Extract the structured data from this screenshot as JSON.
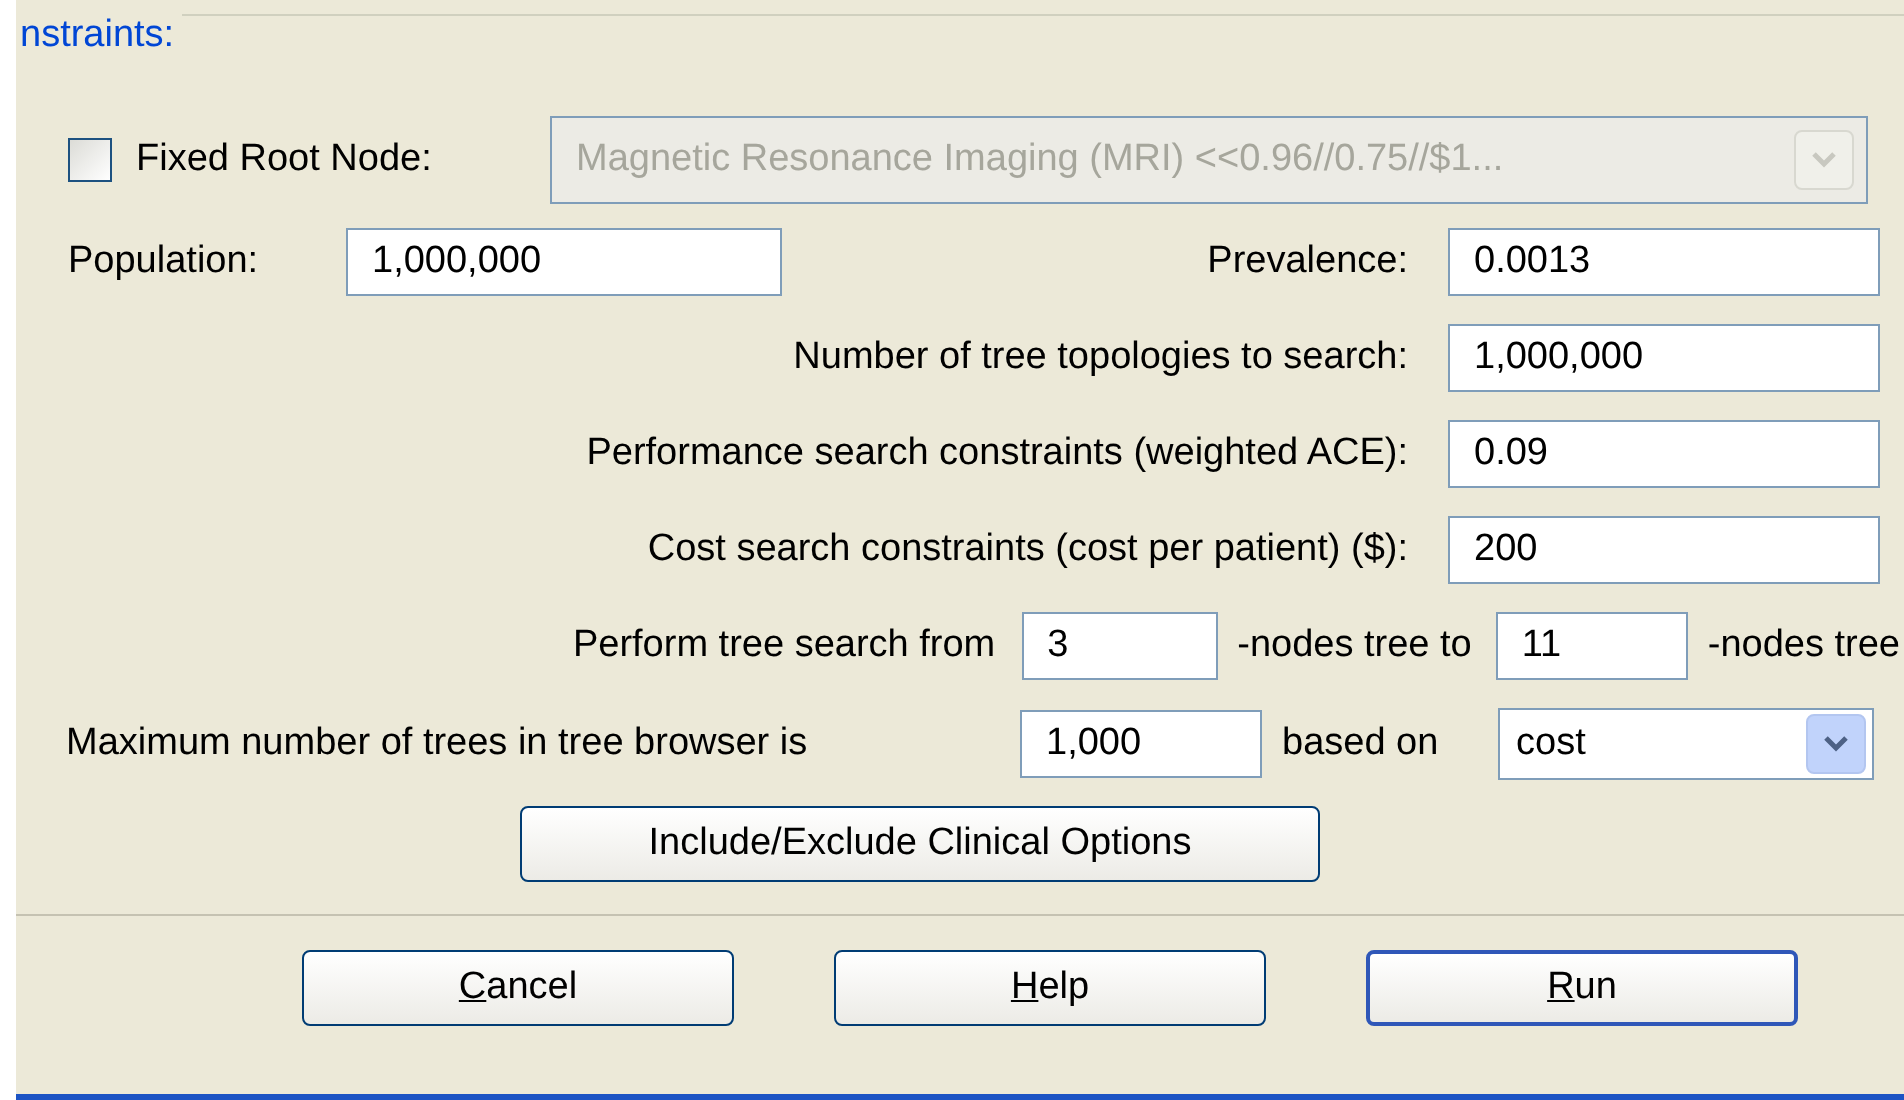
{
  "section_title": "nstraints:",
  "fixed_root": {
    "label": "Fixed Root Node:",
    "checked": false,
    "disabled": true,
    "value": "Magnetic Resonance Imaging (MRI) <<0.96//0.75//$1..."
  },
  "population": {
    "label": "Population:",
    "value": "1,000,000"
  },
  "prevalence": {
    "label": "Prevalence:",
    "value": "0.0013"
  },
  "settings": [
    {
      "label": "Number of tree topologies to search:",
      "value": "1,000,000"
    },
    {
      "label": "Performance search constraints (weighted ACE):",
      "value": "0.09"
    },
    {
      "label": "Cost search constraints (cost per patient) ($):",
      "value": "200"
    }
  ],
  "tree_search": {
    "label": "Perform tree search from",
    "from": "3",
    "middle": "-nodes tree to",
    "to": "11",
    "suffix": "-nodes tree"
  },
  "max_trees": {
    "label": "Maximum number of trees in tree browser is",
    "value": "1,000",
    "based_on_label": "based on",
    "based_on": "cost"
  },
  "options_button": "Include/Exclude Clinical Options",
  "buttons": [
    {
      "label": "Cancel",
      "default": false,
      "mnemonic_underlined": true
    },
    {
      "label": "Help",
      "default": false,
      "mnemonic_underlined": true
    },
    {
      "label": "Run",
      "default": true,
      "mnemonic_underlined": true
    }
  ]
}
